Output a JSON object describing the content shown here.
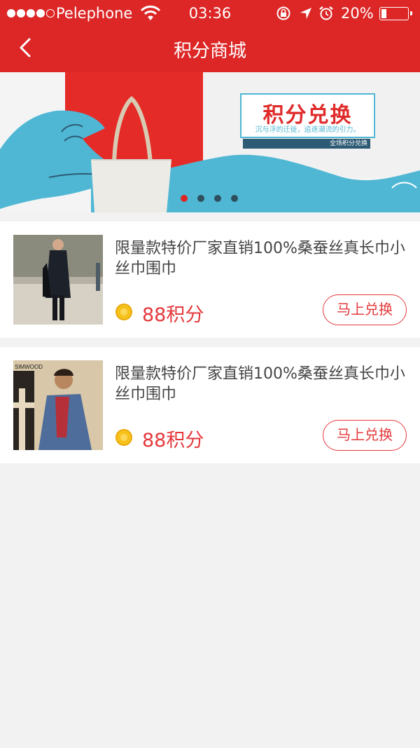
{
  "status_bar": {
    "carrier": "Pelephone",
    "time": "03:36",
    "battery_percent": "20%",
    "battery_level": 0.2
  },
  "nav": {
    "title": "积分商城",
    "back_icon": "chevron-left-icon"
  },
  "banner": {
    "promo_title": "积分兑换",
    "promo_slogan": "沉与浮的迁徙，追逐潮流的引力。",
    "promo_tag": "全场积分兑换",
    "slide_count": 4,
    "active_slide": 0
  },
  "products": [
    {
      "name": "限量款特价厂家直销100%桑蚕丝真长巾小丝巾围巾",
      "points": "88积分",
      "button": "马上兑换",
      "thumb_label": ""
    },
    {
      "name": "限量款特价厂家直销100%桑蚕丝真长巾小丝巾围巾",
      "points": "88积分",
      "button": "马上兑换",
      "thumb_label": "SIMWOOD"
    }
  ],
  "colors": {
    "brand_red": "#dd2727",
    "price_red": "#e4393c",
    "page_bg": "#f2f2f2",
    "wave_blue": "#4fb7d4"
  }
}
